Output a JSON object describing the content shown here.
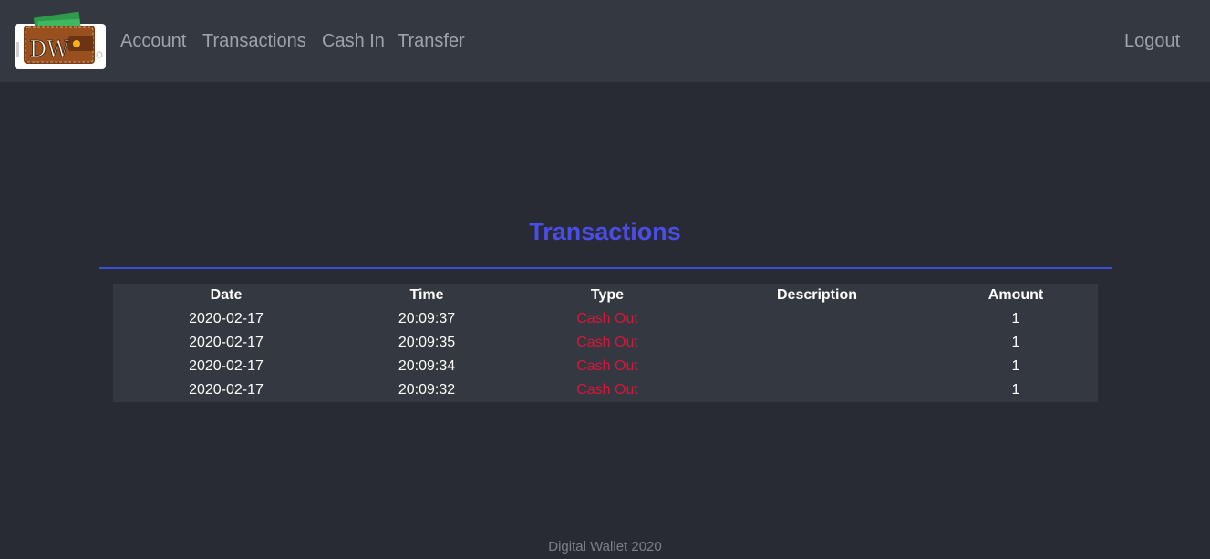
{
  "nav": {
    "links": [
      "Account",
      "Transactions",
      "Cash In",
      "Transfer"
    ],
    "logout": "Logout",
    "logo_text": "DW"
  },
  "page": {
    "title": "Transactions"
  },
  "table": {
    "headers": [
      "Date",
      "Time",
      "Type",
      "Description",
      "Amount"
    ],
    "rows": [
      {
        "date": "2020-02-17",
        "time": "20:09:37",
        "type": "Cash Out",
        "description": "",
        "amount": "1"
      },
      {
        "date": "2020-02-17",
        "time": "20:09:35",
        "type": "Cash Out",
        "description": "",
        "amount": "1"
      },
      {
        "date": "2020-02-17",
        "time": "20:09:34",
        "type": "Cash Out",
        "description": "",
        "amount": "1"
      },
      {
        "date": "2020-02-17",
        "time": "20:09:32",
        "type": "Cash Out",
        "description": "",
        "amount": "1"
      }
    ]
  },
  "footer": {
    "text": "Digital Wallet 2020"
  },
  "colors": {
    "background": "#282b33",
    "navbar": "#343840",
    "title": "#4a4ee6",
    "cash_out": "#d8163a"
  }
}
